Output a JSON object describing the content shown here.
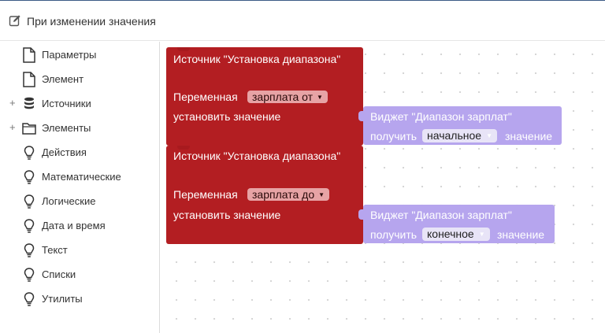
{
  "header": {
    "title": "При изменении значения",
    "icon": "edit-icon"
  },
  "sidebar": {
    "items": [
      {
        "label": "Параметры",
        "icon": "file-icon",
        "expandable": false
      },
      {
        "label": "Элемент",
        "icon": "file-icon",
        "expandable": false
      },
      {
        "label": "Источники",
        "icon": "database-icon",
        "expandable": true
      },
      {
        "label": "Элементы",
        "icon": "folder-icon",
        "expandable": true
      },
      {
        "label": "Действия",
        "icon": "lightbulb-icon",
        "expandable": false
      },
      {
        "label": "Математические",
        "icon": "lightbulb-icon",
        "expandable": false
      },
      {
        "label": "Логические",
        "icon": "lightbulb-icon",
        "expandable": false
      },
      {
        "label": "Дата и время",
        "icon": "lightbulb-icon",
        "expandable": false
      },
      {
        "label": "Текст",
        "icon": "lightbulb-icon",
        "expandable": false
      },
      {
        "label": "Списки",
        "icon": "lightbulb-icon",
        "expandable": false
      },
      {
        "label": "Утилиты",
        "icon": "lightbulb-icon",
        "expandable": false
      }
    ],
    "expand_symbol": "+"
  },
  "blocks": [
    {
      "source_title": "Источник \"Установка диапазона\"",
      "variable_label": "Переменная",
      "variable_value": "зарплата от",
      "set_label": "установить значение",
      "widget": {
        "title": "Виджет \"Диапазон зарплат\"",
        "get_label": "получить",
        "value": "начальное",
        "suffix": "значение"
      }
    },
    {
      "source_title": "Источник \"Установка диапазона\"",
      "variable_label": "Переменная",
      "variable_value": "зарплата до",
      "set_label": "установить значение",
      "widget": {
        "title": "Виджет \"Диапазон зарплат\"",
        "get_label": "получить",
        "value": "конечное",
        "suffix": "значение"
      }
    }
  ],
  "dropdown_arrow": "▼",
  "colors": {
    "source_block": "#b31e22",
    "widget_block": "#b6a5ee",
    "header_accent": "#3b5a85"
  }
}
